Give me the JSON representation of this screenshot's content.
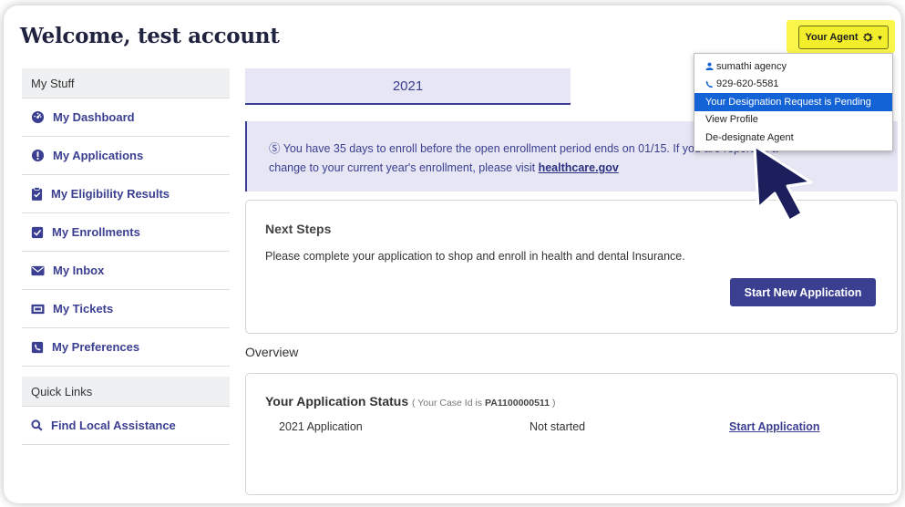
{
  "header": {
    "welcome": "Welcome, test account",
    "agent_button": "Your Agent"
  },
  "agent_menu": {
    "name": "sumathi agency",
    "phone": "929-620-5581",
    "items": [
      "Your Designation Request is Pending",
      "View Profile",
      "De-designate Agent"
    ]
  },
  "sidebar": {
    "my_stuff_heading": "My Stuff",
    "items": [
      {
        "label": "My Dashboard",
        "icon": "dashboard-icon"
      },
      {
        "label": "My Applications",
        "icon": "info-icon"
      },
      {
        "label": "My Eligibility Results",
        "icon": "clipboard-check-icon"
      },
      {
        "label": "My Enrollments",
        "icon": "checkbox-icon"
      },
      {
        "label": "My Inbox",
        "icon": "envelope-icon"
      },
      {
        "label": "My Tickets",
        "icon": "ticket-icon"
      },
      {
        "label": "My Preferences",
        "icon": "preferences-icon"
      }
    ],
    "quick_links_heading": "Quick Links",
    "quick_links": [
      {
        "label": "Find Local Assistance",
        "icon": "search-icon"
      }
    ]
  },
  "main": {
    "year_tab": "2021",
    "notice_line1": "Ⓢ You have 35 days to enroll before the open enrollment period ends on 01/15. If you are reporting a",
    "notice_line2_prefix": "change to your current year's enrollment, please visit ",
    "notice_link": "healthcare.gov",
    "next_steps_title": "Next Steps",
    "next_steps_text": "Please complete your application to shop and enroll in health and dental Insurance.",
    "start_new_button": "Start New Application",
    "overview_heading": "Overview",
    "status_title": "Your Application Status",
    "case_prefix": "( Your Case Id is ",
    "case_id": "PA1100000511",
    "case_suffix": " )",
    "application": {
      "name": "2021 Application",
      "status": "Not started",
      "action": "Start Application"
    }
  },
  "colors": {
    "primary": "#3b3f91",
    "highlight": "#fbf74a",
    "selected_menu": "#1463d6",
    "notice_bg": "#e6e6f4"
  }
}
